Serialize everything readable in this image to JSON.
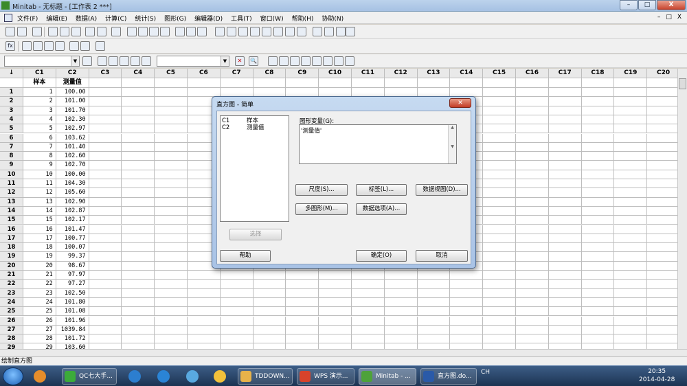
{
  "window": {
    "title": "Minitab - 无标题 - [工作表 2 ***]",
    "min": "–",
    "max": "□",
    "close": "X"
  },
  "menu": {
    "items": [
      "文件(F)",
      "编辑(E)",
      "数据(A)",
      "计算(C)",
      "统计(S)",
      "图形(G)",
      "编辑器(D)",
      "工具(T)",
      "窗口(W)",
      "帮助(H)",
      "协助(N)"
    ],
    "mdi": [
      "–",
      "□",
      "X"
    ]
  },
  "toolbar": {
    "fx_icon": "fx",
    "close_x": "✕",
    "zoom_icon": "🔍"
  },
  "columns": {
    "ids": [
      "C1",
      "C2",
      "C3",
      "C4",
      "C5",
      "C6",
      "C7",
      "C8",
      "C9",
      "C10",
      "C11",
      "C12",
      "C13",
      "C14",
      "C15",
      "C16",
      "C17",
      "C18",
      "C19",
      "C20"
    ],
    "names": [
      "样本",
      "测量值"
    ],
    "corner": "↓"
  },
  "rows": [
    [
      "1",
      "1",
      "100.00"
    ],
    [
      "2",
      "2",
      "101.00"
    ],
    [
      "3",
      "3",
      "101.70"
    ],
    [
      "4",
      "4",
      "102.30"
    ],
    [
      "5",
      "5",
      "102.97"
    ],
    [
      "6",
      "6",
      "103.62"
    ],
    [
      "7",
      "7",
      "101.40"
    ],
    [
      "8",
      "8",
      "102.60"
    ],
    [
      "9",
      "9",
      "102.70"
    ],
    [
      "10",
      "10",
      "100.00"
    ],
    [
      "11",
      "11",
      "104.30"
    ],
    [
      "12",
      "12",
      "105.60"
    ],
    [
      "13",
      "13",
      "102.90"
    ],
    [
      "14",
      "14",
      "102.87"
    ],
    [
      "15",
      "15",
      "102.17"
    ],
    [
      "16",
      "16",
      "101.47"
    ],
    [
      "17",
      "17",
      "100.77"
    ],
    [
      "18",
      "18",
      "100.07"
    ],
    [
      "19",
      "19",
      "99.37"
    ],
    [
      "20",
      "20",
      "98.67"
    ],
    [
      "21",
      "21",
      "97.97"
    ],
    [
      "22",
      "22",
      "97.27"
    ],
    [
      "23",
      "23",
      "102.50"
    ],
    [
      "24",
      "24",
      "101.80"
    ],
    [
      "25",
      "25",
      "101.08"
    ],
    [
      "26",
      "26",
      "101.96"
    ],
    [
      "27",
      "27",
      "1039.84"
    ],
    [
      "28",
      "28",
      "101.72"
    ],
    [
      "29",
      "29",
      "103.60"
    ]
  ],
  "status": "绘制直方图",
  "dialog": {
    "title": "直方图 - 简单",
    "close": "✕",
    "variables": [
      {
        "col": "C1",
        "name": "样本"
      },
      {
        "col": "C2",
        "name": "测量值"
      }
    ],
    "graph_var_label": "图形变量(G):",
    "graph_var_value": "'测量值'",
    "buttons": {
      "scale": "尺度(S)...",
      "labels": "标签(L)...",
      "data_view": "数据视图(D)...",
      "multiple": "多图形(M)...",
      "data_options": "数据选项(A)...",
      "select": "选择",
      "help": "帮助",
      "ok": "确定(O)",
      "cancel": "取消"
    }
  },
  "taskbar": {
    "apps": [
      "QC七大手...",
      "TDDOWN...",
      "WPS 演示...",
      "Minitab - ...",
      "直方图.do..."
    ],
    "lang": "CH",
    "time": "20:35",
    "date": "2014-04-28"
  }
}
